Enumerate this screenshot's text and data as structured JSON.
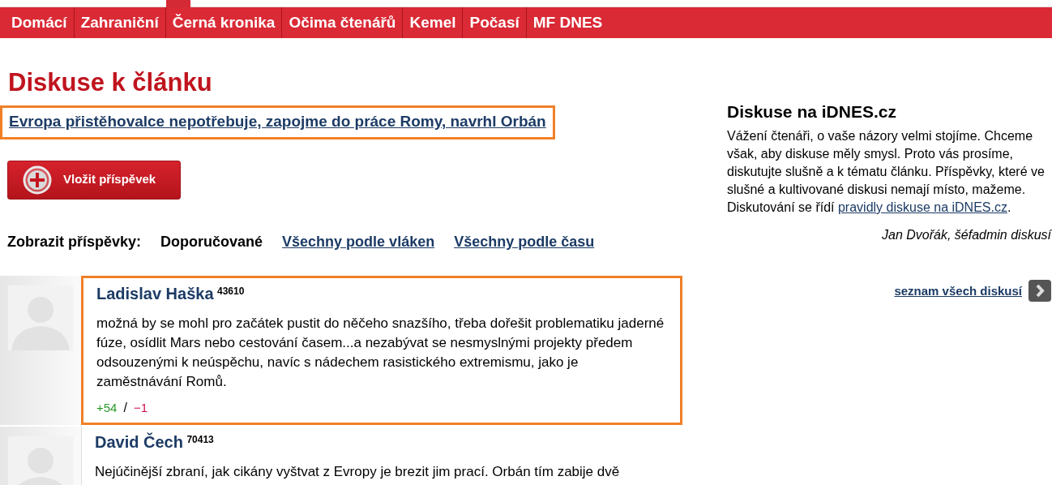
{
  "nav": {
    "items": [
      "Domácí",
      "Zahraniční",
      "Černá kronika",
      "Očima čtenářů",
      "Kemel",
      "Počasí",
      "MF DNES"
    ]
  },
  "main": {
    "heading": "Diskuse k článku",
    "article_link": {
      "text": "Evropa přistěhovalce nepotřebuje, zapojme do práce Romy, navrhl Orbán",
      "highlighted": true
    },
    "post_button": "Vložit příspěvek",
    "filter": {
      "label": "Zobrazit příspěvky:",
      "options": [
        {
          "label": "Doporučované",
          "selected": true
        },
        {
          "label": "Všechny podle vláken",
          "selected": false
        },
        {
          "label": "Všechny podle času",
          "selected": false
        }
      ]
    },
    "comments": [
      {
        "author": "Ladislav Haška",
        "score": "43610",
        "text": "možná by se mohl pro začátek pustit do něčeho snazšího, třeba dořešit problematiku jaderné fúze, osídlit Mars nebo cestování časem...a nezabývat se nesmyslnými projekty předem odsouzenými k neúspěchu, navíc s nádechem rasistického extremismu, jako je zaměstnávání Romů.",
        "votes_up": "+54",
        "vote_separator": "/",
        "votes_down": "−1",
        "highlighted": true
      },
      {
        "author": "David Čech",
        "score": "70413",
        "text": "Nejúčinější zbraní, jak cikány vyštvat z Evropy je brezit jim prací. Orbán tím zabije dvě",
        "highlighted": false
      }
    ]
  },
  "sidebar": {
    "title": "Diskuse na iDNES.cz",
    "text": "Vážení čtenáři, o vaše názory velmi stojíme. Chceme však, aby diskuse měly smysl. Proto vás prosíme, diskutujte slušně a k tématu článku. Příspěvky, které ve slušné a kultivované diskusi nemají místo, mažeme. Diskutování se řídí ",
    "rules_link": "pravidly diskuse na iDNES.cz",
    "text_end": ".",
    "signature": "Jan Dvořák, šéfadmin diskusí",
    "all_link": "seznam všech diskusí"
  }
}
